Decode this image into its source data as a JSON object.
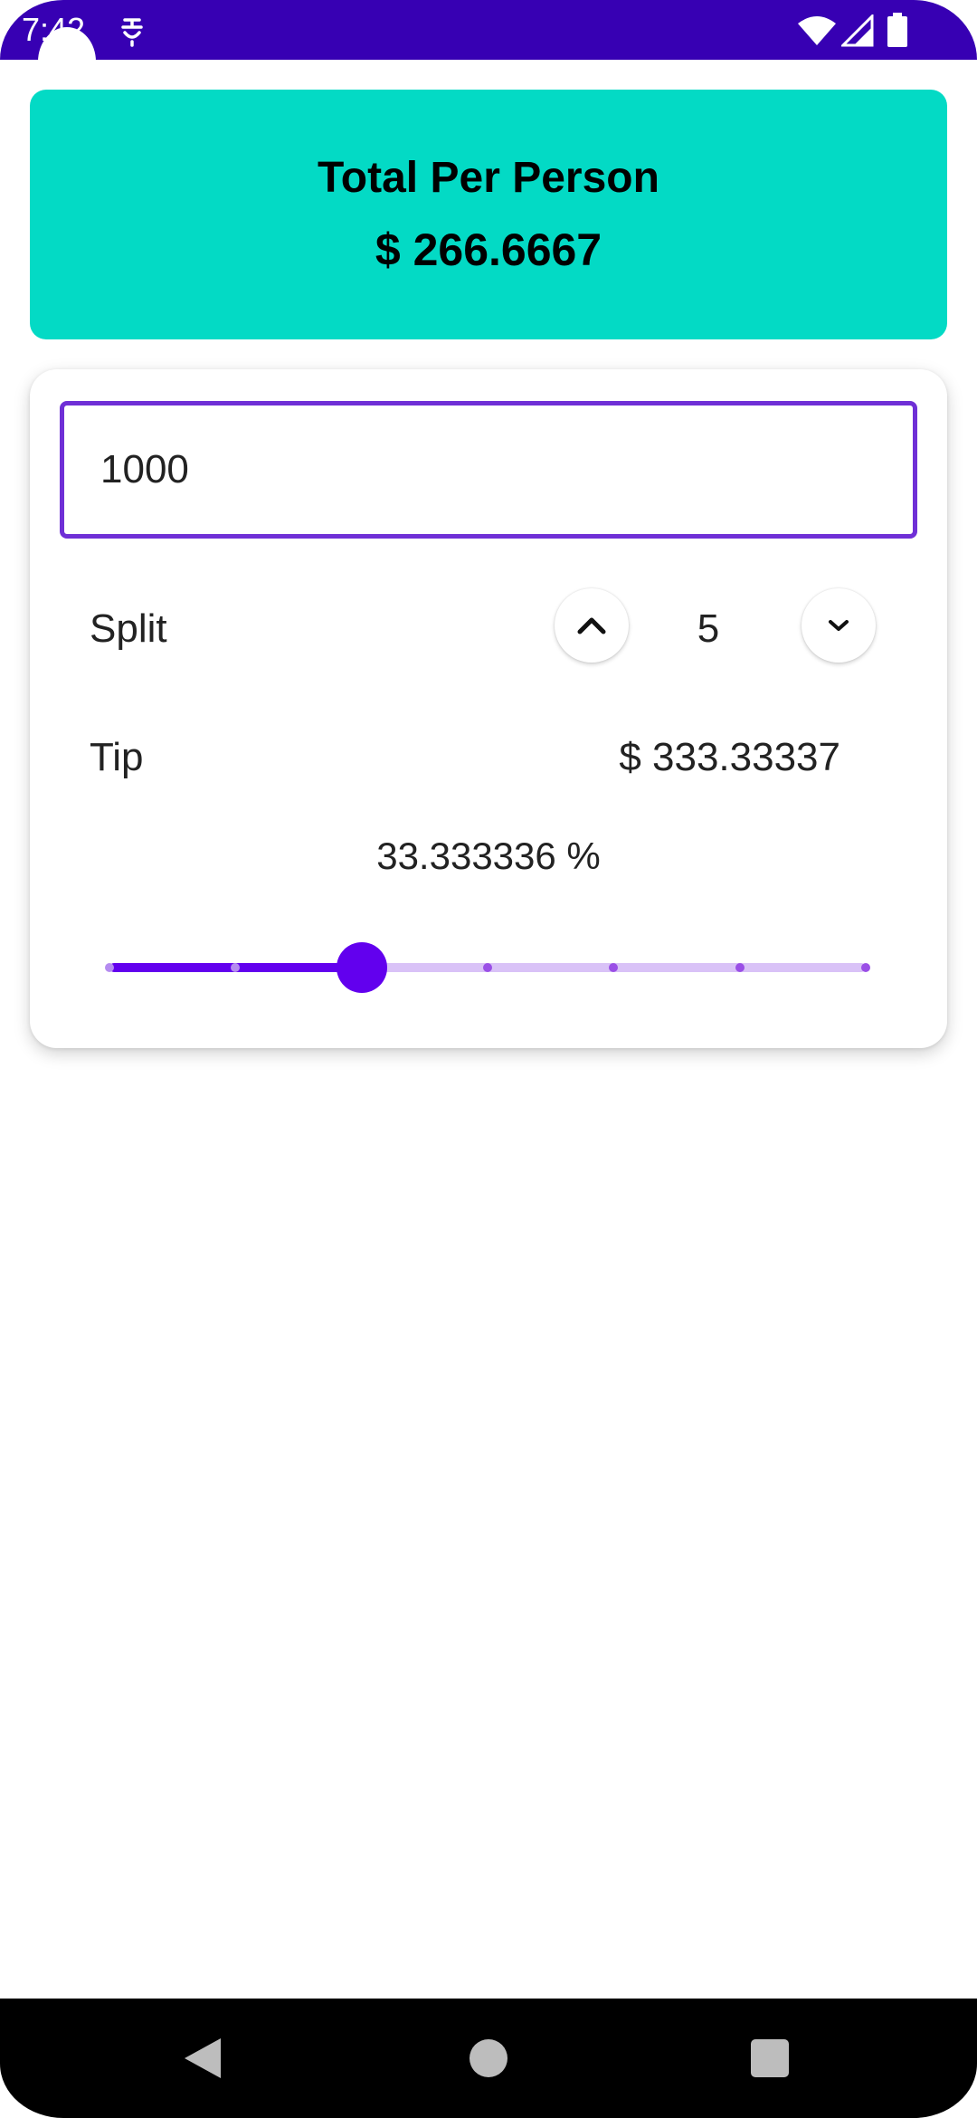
{
  "status_bar": {
    "time": "7:42",
    "background_color": "#3700b3",
    "icons": [
      "notification-icon",
      "wifi-icon",
      "signal-icon",
      "battery-icon"
    ]
  },
  "summary": {
    "title": "Total Per Person",
    "amount": "$ 266.6667",
    "background_color": "#03dac5"
  },
  "bill": {
    "value": "1000",
    "border_color": "#6f2fd6"
  },
  "split": {
    "label": "Split",
    "value": "5",
    "increment_icon": "chevron-up-icon",
    "decrement_icon": "chevron-down-icon"
  },
  "tip": {
    "label": "Tip",
    "amount": "$ 333.33337",
    "percent_text": "33.333336 %"
  },
  "slider": {
    "fraction": 0.3333,
    "steps": 7,
    "active_color": "#6200ee",
    "inactive_color": "#d9c2f7"
  },
  "nav_bar": {
    "icons": [
      "back-icon",
      "home-icon",
      "recents-icon"
    ]
  }
}
